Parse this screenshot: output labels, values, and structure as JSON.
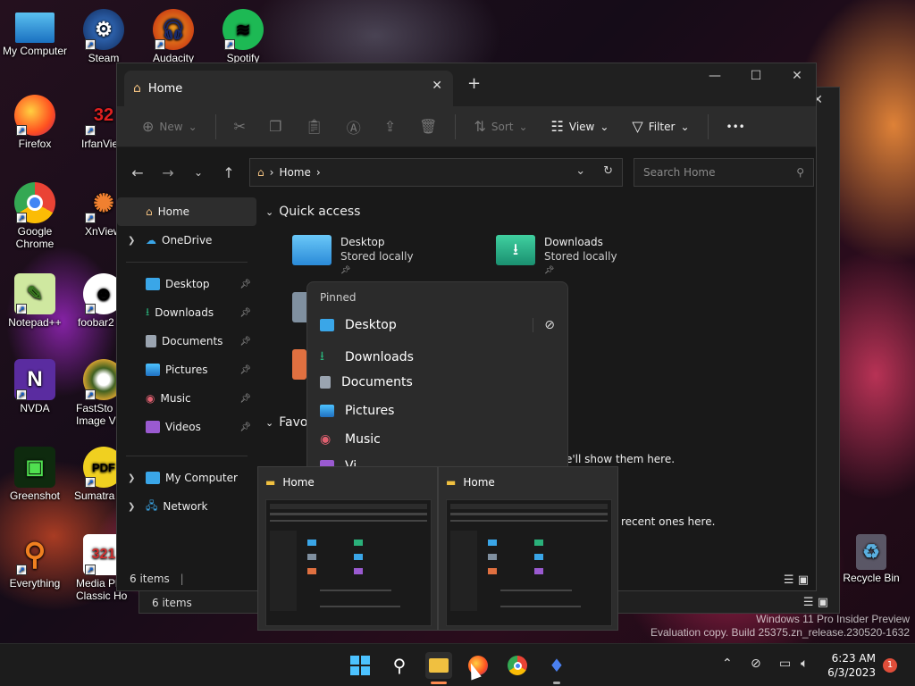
{
  "desktop": {
    "icons": [
      {
        "label": "My Computer",
        "icon": "monitor-icon",
        "color": "#3aa0e0"
      },
      {
        "label": "Steam",
        "icon": "steam-icon",
        "color": "#1b3a6b"
      },
      {
        "label": "Audacity",
        "icon": "audacity-icon",
        "color": "#f0a020"
      },
      {
        "label": "Spotify",
        "icon": "spotify-icon",
        "color": "#1db954"
      },
      {
        "label": "Firefox",
        "icon": "firefox-icon",
        "color": "#ff7b20"
      },
      {
        "label": "IrfanVie",
        "icon": "irfanview-icon",
        "color": "#c02020"
      },
      {
        "label": "Google Chrome",
        "icon": "chrome-icon",
        "color": "#4285f4"
      },
      {
        "label": "XnView",
        "icon": "xnview-icon",
        "color": "#e07020"
      },
      {
        "label": "Notepad++",
        "icon": "notepadpp-icon",
        "color": "#80c040"
      },
      {
        "label": "foobar2",
        "icon": "foobar-icon",
        "color": "#eeeeee"
      },
      {
        "label": "NVDA",
        "icon": "nvda-icon",
        "color": "#5a2ca0"
      },
      {
        "label": "FastSto Image Vi",
        "icon": "faststone-icon",
        "color": "#d0a030"
      },
      {
        "label": "Greenshot",
        "icon": "greenshot-icon",
        "color": "#2a8a2a"
      },
      {
        "label": "Sumatra",
        "icon": "sumatra-icon",
        "color": "#f0d020"
      },
      {
        "label": "Everything",
        "icon": "everything-icon",
        "color": "#f08020"
      },
      {
        "label": "Media Pl Classic Ho",
        "icon": "mpc-icon",
        "color": "#d03030"
      },
      {
        "label": "Recycle Bin",
        "icon": "recycle-bin-icon",
        "color": "#5ab0e0"
      }
    ]
  },
  "explorer": {
    "tab_label": "Home",
    "new_tab": "+",
    "commands": {
      "new": "New",
      "sort": "Sort",
      "view": "View",
      "filter": "Filter",
      "more": "•••"
    },
    "address": {
      "home": "Home"
    },
    "search_placeholder": "Search Home",
    "sidebar": [
      {
        "label": "Home",
        "active": true
      },
      {
        "label": "OneDrive"
      },
      {
        "label": "Desktop"
      },
      {
        "label": "Downloads"
      },
      {
        "label": "Documents"
      },
      {
        "label": "Pictures"
      },
      {
        "label": "Music"
      },
      {
        "label": "Videos"
      },
      {
        "label": "My Computer"
      },
      {
        "label": "Network"
      }
    ],
    "quick_access": {
      "heading": "Quick access",
      "items": [
        {
          "name": "Desktop",
          "sub": "Stored locally"
        },
        {
          "name": "Downloads",
          "sub": "Stored locally"
        },
        {
          "name": "es",
          "sub": "locally"
        },
        {
          "name": "s",
          "sub": "locally"
        }
      ]
    },
    "favorites": {
      "heading": "Favor",
      "empty_text": "e'll show them here."
    },
    "recent": {
      "empty_text": "recent ones here."
    },
    "status": "6 items"
  },
  "rear_window": {
    "status": "6 items"
  },
  "jumplist": {
    "title": "Pinned",
    "items": [
      "Desktop",
      "Downloads",
      "Documents",
      "Pictures",
      "Music",
      "Vi"
    ]
  },
  "thumbnails": [
    {
      "title": "Home"
    },
    {
      "title": "Home"
    }
  ],
  "watermark": {
    "line1": "Windows 11 Pro Insider Preview",
    "line2": "Evaluation copy. Build 25375.zn_release.230520-1632"
  },
  "taskbar": {
    "time": "6:23 AM",
    "date": "6/3/2023",
    "notifications": "1"
  },
  "colors": {
    "accent": "#4cc2ff",
    "folder_blue": "#3aa6e8",
    "folder_green": "#2ab07a",
    "folder_yellow": "#f0c040"
  }
}
